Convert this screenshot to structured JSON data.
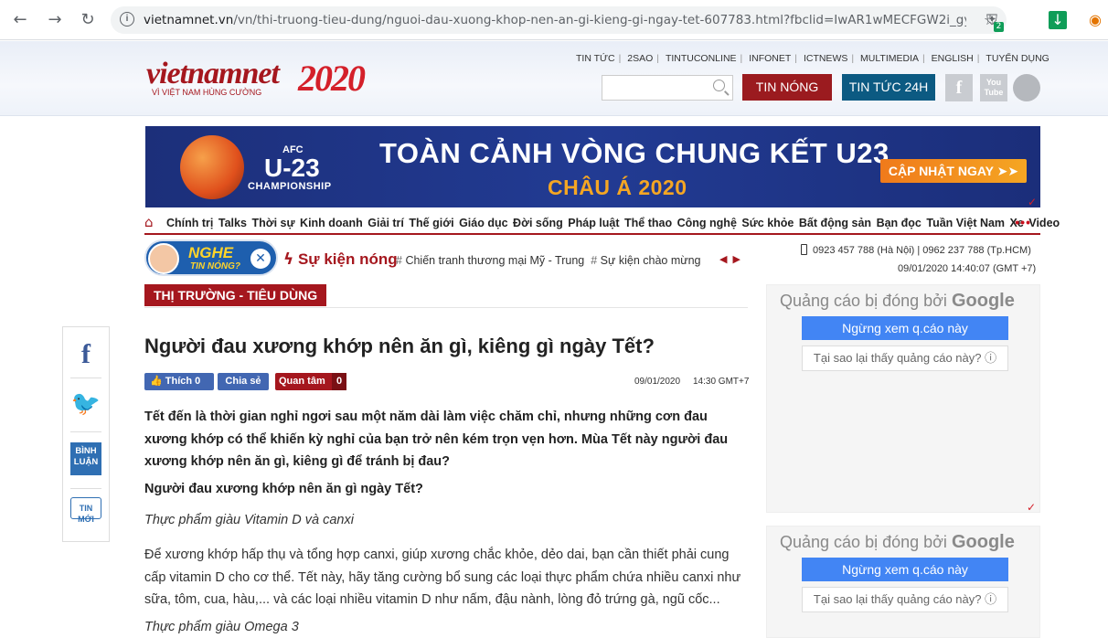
{
  "browser": {
    "url_domain": "vietnamnet.vn",
    "url_path": "/vn/thi-truong-tieu-dung/nguoi-dau-xuong-khop-nen-an-gi-kieng-gi-ngay-tet-607783.html?fbclid=IwAR1wMECFGW2i_gy6Huead...",
    "ext_badge": "2"
  },
  "header": {
    "logo_main": "vietnam",
    "logo_net": "net",
    "logo_tagline": "VÌ VIỆT NAM HÙNG CƯỜNG",
    "logo_year": "2020",
    "top_links": [
      "TIN TỨC",
      "2SAO",
      "TINTUCONLINE",
      "INFONET",
      "ICTNEWS",
      "MULTIMEDIA",
      "ENGLISH",
      "TUYỂN DỤNG"
    ],
    "search_placeholder": "",
    "btn_hot": "TIN NÓNG",
    "btn_24h": "TIN TỨC 24H",
    "youtube_label": "You Tube"
  },
  "banner": {
    "afc": "AFC",
    "u23": "U-23",
    "championship": "CHAMPIONSHIP",
    "title": "TOÀN CẢNH VÒNG CHUNG KẾT U23",
    "subtitle": "CHÂU Á 2020",
    "cta": "CẬP NHẬT NGAY ➤➤"
  },
  "nav": {
    "categories": [
      "Chính trị",
      "Talks",
      "Thời sự",
      "Kinh doanh",
      "Giải trí",
      "Thế giới",
      "Giáo dục",
      "Đời sống",
      "Pháp luật",
      "Thể thao",
      "Công nghệ",
      "Sức khỏe",
      "Bất động sản",
      "Bạn đọc",
      "Tuần Việt Nam",
      "Xe",
      "Video"
    ],
    "more": "•••"
  },
  "hot": {
    "nghe_line1": "NGHE",
    "nghe_line2": "TIN NÓNG?",
    "su_kien": "Sự kiện nóng",
    "topics": [
      "Chiến tranh thương mại Mỹ - Trung",
      "Sự kiện chào mừng"
    ],
    "contact": "0923 457 788 (Hà Nội) | 0962 237 788 (Tp.HCM)",
    "datetime": "09/01/2020 14:40:07 (GMT +7)"
  },
  "section": {
    "label": "THỊ TRƯỜNG - TIÊU DÙNG"
  },
  "share_bar": {
    "binh_luan": "BÌNH LUẬN",
    "tin_moi": "TIN MỚI"
  },
  "article": {
    "headline": "Người đau xương khớp nên ăn gì, kiêng gì ngày Tết?",
    "like_label": "Thích 0",
    "share_label": "Chia sẻ",
    "follow_label": "Quan tâm",
    "follow_count": "0",
    "date": "09/01/2020",
    "time": "14:30 GMT+7",
    "lead": "Tết đến là thời gian nghỉ ngơi sau một năm dài làm việc chăm chỉ, nhưng những cơn đau xương khớp có thể khiến kỳ nghỉ của bạn trở nên kém trọn vẹn hơn. Mùa Tết này người đau xương khớp nên ăn gì, kiêng gì để tránh bị đau?",
    "subhead": "Người đau xương khớp nên ăn gì ngày Tết?",
    "italic1": "Thực phẩm giàu Vitamin D và canxi",
    "paragraph": "Để xương khớp hấp thụ và tổng hợp canxi, giúp xương chắc khỏe, dẻo dai, bạn cần thiết phải cung cấp vitamin D cho cơ thể. Tết này, hãy tăng cường bổ sung các loại thực phẩm chứa nhiều canxi như sữa, tôm, cua, hàu,... và các loại nhiều vitamin D như nấm, đậu nành, lòng đỏ trứng gà, ngũ cốc...",
    "italic2": "Thực phẩm giàu Omega 3"
  },
  "ads": {
    "closed_by": "Quảng cáo bị đóng bởi",
    "google": "Google",
    "stop_label": "Ngừng xem q.cáo này",
    "why_label": "Tại sao lại thấy quảng cáo này? ⓘ"
  },
  "colors": {
    "brand_red": "#a5171e",
    "news24_blue": "#0c5a82",
    "google_blue": "#4285f4"
  }
}
